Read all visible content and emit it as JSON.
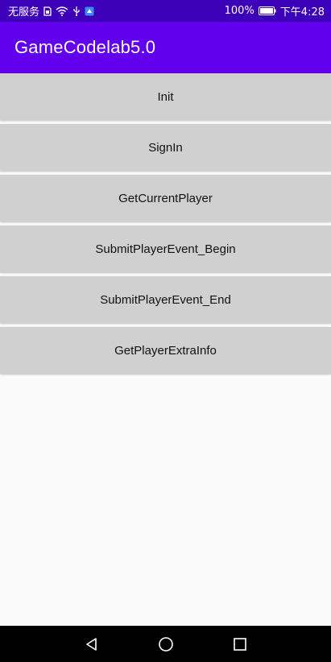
{
  "status_bar": {
    "carrier": "无服务",
    "battery_percent": "100%",
    "time": "下午4:28",
    "icons": [
      "sim-icon",
      "wifi-icon",
      "usb-icon",
      "app-notification-icon",
      "battery-icon"
    ]
  },
  "app_bar": {
    "title": "GameCodelab5.0"
  },
  "buttons": [
    {
      "label": "Init"
    },
    {
      "label": "SignIn"
    },
    {
      "label": "GetCurrentPlayer"
    },
    {
      "label": "SubmitPlayerEvent_Begin"
    },
    {
      "label": "SubmitPlayerEvent_End"
    },
    {
      "label": "GetPlayerExtraInfo"
    }
  ],
  "nav_bar": {
    "icons": [
      "back-icon",
      "home-icon",
      "recents-icon"
    ]
  },
  "colors": {
    "status_bar": "#3c00b8",
    "app_bar": "#6200ee",
    "button_bg": "#d0d0d0",
    "page_bg": "#fafafa",
    "nav_bar": "#000000"
  }
}
